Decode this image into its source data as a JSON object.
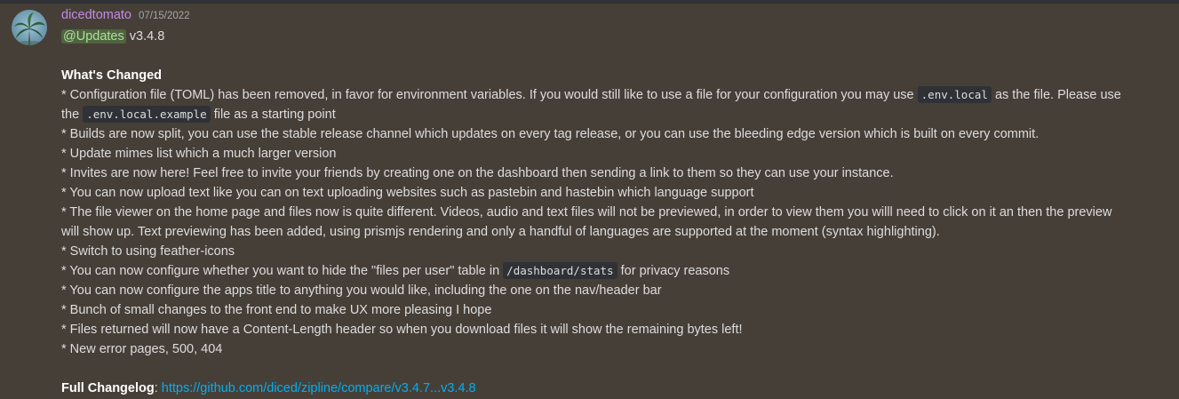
{
  "message": {
    "username": "dicedtomato",
    "timestamp": "07/15/2022",
    "mention": "@Updates",
    "version": "v3.4.8",
    "whats_changed_heading": "What's Changed",
    "bullets": {
      "config_1": "* Configuration file (TOML) has been removed, in favor for environment variables. If you would still like to use a file for your configuration you may use",
      "config_code_1": ".env.local",
      "config_2": "as the file. Please use",
      "config_3": "the",
      "config_code_2": ".env.local.example",
      "config_4": "file as a starting point",
      "builds": "* Builds are now split, you can use the stable release channel which updates on every tag release, or you can use the bleeding edge version which is built on every commit.",
      "mimes": "* Update mimes list which a much larger version",
      "invites": "* Invites are now here! Feel free to invite your friends by creating one on the dashboard then sending a link to them so they can use your instance.",
      "text_upload": "* You can now upload text like you can on text uploading websites such as pastebin and hastebin which language support",
      "viewer_1": "* The file viewer on the home page and files now is quite different. Videos, audio and text files will not be previewed, in order to view them you willl need to click on it an then the preview",
      "viewer_2": "will show up. Text previewing has been added, using prismjs rendering and only a handful of languages are supported at the moment (syntax highlighting).",
      "feather": "* Switch to using feather-icons",
      "stats_1": "* You can now configure whether you want to hide the \"files per user\" table in",
      "stats_code": "/dashboard/stats",
      "stats_2": "for privacy reasons",
      "title": "* You can now configure the apps title to anything you would like, including the one on the nav/header bar",
      "frontend": "* Bunch of small changes to the front end to make UX more pleasing I hope",
      "content_length": "* Files returned will now have a Content-Length header so when you download files it will show the remaining bytes left!",
      "errors": "* New error pages, 500, 404"
    },
    "full_changelog_label": "Full Changelog",
    "full_changelog_sep": ":",
    "full_changelog_link": "https://github.com/diced/zipline/compare/v3.4.7...v3.4.8"
  },
  "colors": {
    "background": "#463f37",
    "username": "#c48ae8",
    "link": "#00aff4",
    "mention": "#a8e29b"
  },
  "icons": {
    "avatar": "palm-tree-avatar"
  }
}
